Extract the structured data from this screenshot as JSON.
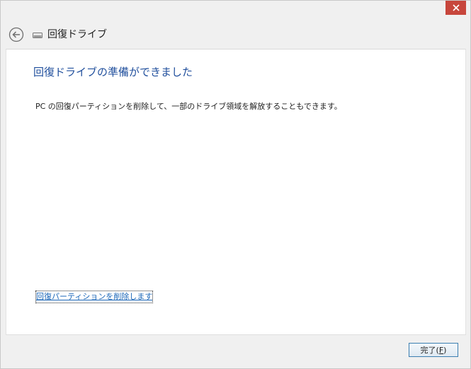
{
  "window": {
    "title": "回復ドライブ"
  },
  "content": {
    "heading": "回復ドライブの準備ができました",
    "body": "PC の回復パーティションを削除して、一部のドライブ領域を解放することもできます。",
    "delete_link": "回復パーティションを削除します"
  },
  "footer": {
    "finish_label_prefix": "完了(",
    "finish_label_mnemonic": "F",
    "finish_label_suffix": ")"
  },
  "colors": {
    "heading": "#1f4e9c",
    "link": "#1a66b8",
    "close_button": "#c7463c",
    "button_border": "#3c7fb1"
  },
  "icons": {
    "close": "close-icon",
    "back": "back-arrow-icon",
    "drive": "drive-icon"
  }
}
